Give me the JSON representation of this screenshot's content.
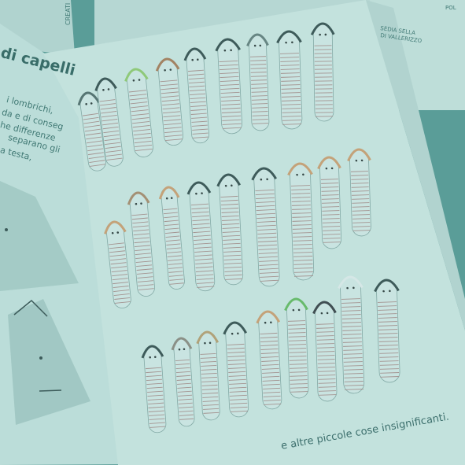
{
  "left_page": {
    "heading": "di capelli",
    "lines": [
      "i lombrichi,",
      "da e di conseg",
      "he differenze",
      "separano gli",
      "a testa,"
    ]
  },
  "top_book": {
    "brand": "CREATI",
    "spine_left": "SEDIA SELLA",
    "spine_right": "DI VALLERIZZO",
    "corner": "POL"
  },
  "caption": "e altre piccole cose insignificanti.",
  "colors": {
    "background": "#5f9a95",
    "page": "#dcece8",
    "worm_stripe": "#b88e8c",
    "hair_dark": "#3c4a4a",
    "hair_orange": "#e0a070"
  }
}
